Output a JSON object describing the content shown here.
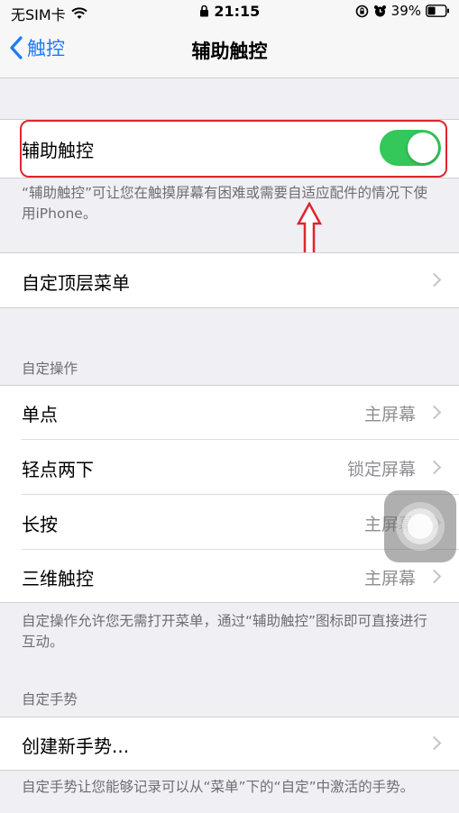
{
  "status_bar": {
    "carrier": "无SIM卡",
    "time": "21:15",
    "battery_percent": "39%",
    "icons": [
      "wifi-icon",
      "lock-icon",
      "orientation-lock-icon",
      "alarm-icon",
      "battery-icon"
    ]
  },
  "nav": {
    "back_label": "触控",
    "title": "辅助触控"
  },
  "assistive_touch": {
    "label": "辅助触控",
    "enabled": true,
    "description": "“辅助触控”可让您在触摸屏幕有困难或需要自适应配件的情况下使用iPhone。"
  },
  "top_menu": {
    "label": "自定顶层菜单"
  },
  "custom_actions": {
    "header": "自定操作",
    "items": [
      {
        "label": "单点",
        "value": "主屏幕"
      },
      {
        "label": "轻点两下",
        "value": "锁定屏幕"
      },
      {
        "label": "长按",
        "value": "主屏幕"
      },
      {
        "label": "三维触控",
        "value": "主屏幕"
      }
    ],
    "footer": "自定操作允许您无需打开菜单，通过“辅助触控”图标即可直接进行互动。"
  },
  "custom_gestures": {
    "header": "自定手势",
    "create_label": "创建新手势...",
    "footer": "自定手势让您能够记录可以从“菜单”下的“自定”中激活的手势。"
  },
  "colors": {
    "accent": "#1a7cf5",
    "toggle_on": "#34c759",
    "annotation": "#e0242d"
  }
}
